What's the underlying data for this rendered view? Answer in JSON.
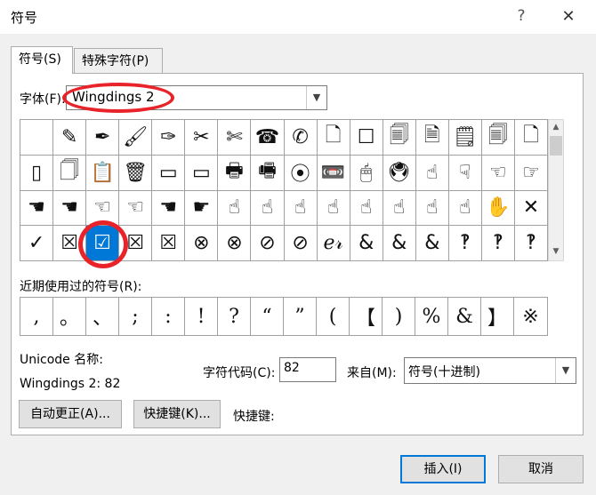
{
  "window": {
    "title": "符号",
    "help_icon": "?",
    "close_icon": "✕"
  },
  "tabs": [
    {
      "label": "符号(S)",
      "active": true
    },
    {
      "label": "特殊字符(P)",
      "active": false
    }
  ],
  "font": {
    "label": "字体(F):",
    "value": "Wingdings 2"
  },
  "symbols": [
    "",
    "✎",
    "✒",
    "🖌",
    "✑",
    "✂",
    "✄",
    "☎",
    "✆",
    "🗋",
    "☐",
    "🗐",
    "🗎",
    "🗒",
    "🗐",
    "🗋",
    "▯",
    "🗍",
    "📋",
    "🗑",
    "▭",
    "▭",
    "🖶",
    "🖷",
    "⦿",
    "📼",
    "🖱",
    "🖲",
    "☝",
    "☟",
    "☜",
    "☞",
    "☚",
    "☚",
    "☜",
    "☜",
    "☚",
    "☛",
    "☝",
    "☝",
    "☝",
    "☝",
    "☝",
    "☝",
    "☝",
    "☝",
    "✋",
    "✕",
    "✓",
    "☒",
    "☑",
    "☒",
    "☒",
    "⊗",
    "⊗",
    "⊘",
    "⊘",
    "ℯ𝓇",
    "&",
    "&",
    "&",
    "‽",
    "‽",
    "‽"
  ],
  "selected_index": 50,
  "recent": {
    "label": "近期使用过的符号(R):",
    "items": [
      ",",
      "。",
      "、",
      ";",
      ":",
      "!",
      "?",
      "“",
      "”",
      "(",
      "【",
      ")",
      "%",
      "&",
      "】",
      "※"
    ]
  },
  "unicode": {
    "label": "Unicode 名称:",
    "value": "Wingdings 2: 82"
  },
  "char_code": {
    "label": "字符代码(C):",
    "value": "82"
  },
  "from": {
    "label": "来自(M):",
    "value": "符号(十进制)"
  },
  "buttons": {
    "autocorrect": "自动更正(A)...",
    "shortcut_key": "快捷键(K)...",
    "insert": "插入(I)",
    "cancel": "取消"
  },
  "shortcut": {
    "label": "快捷键:"
  },
  "colors": {
    "accent": "#0078d7",
    "highlight": "#e8232a"
  }
}
